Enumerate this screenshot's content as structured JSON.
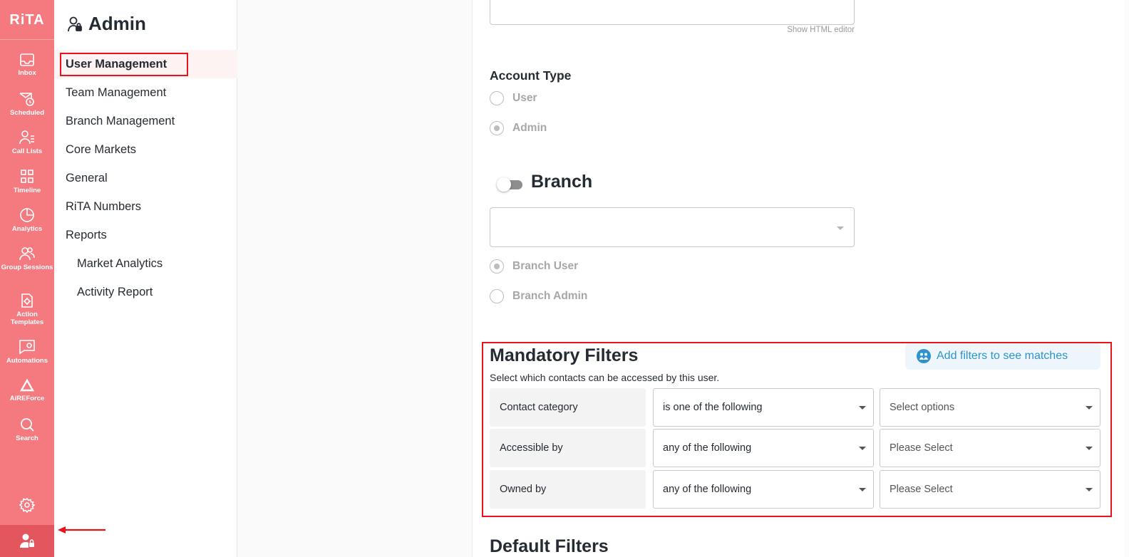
{
  "rail": {
    "logo": "RiTA",
    "items": [
      {
        "label": "Inbox",
        "icon": "inbox-icon"
      },
      {
        "label": "Scheduled",
        "icon": "scheduled-icon"
      },
      {
        "label": "Call Lists",
        "icon": "call-lists-icon"
      },
      {
        "label": "Timeline",
        "icon": "timeline-icon"
      },
      {
        "label": "Analytics",
        "icon": "analytics-icon"
      },
      {
        "label": "Group Sessions",
        "icon": "group-sessions-icon"
      },
      {
        "label": "Action Templates",
        "icon": "action-templates-icon"
      },
      {
        "label": "Automations",
        "icon": "automations-icon"
      },
      {
        "label": "AiREForce",
        "icon": "aireforce-icon"
      },
      {
        "label": "Search",
        "icon": "search-icon"
      }
    ],
    "bottom": [
      "settings-icon",
      "admin-user-icon"
    ],
    "color": "#f47a80",
    "active_color": "#e4565e"
  },
  "nav": {
    "title": "Admin",
    "items": [
      {
        "label": "User Management",
        "active": true
      },
      {
        "label": "Team Management"
      },
      {
        "label": "Branch Management"
      },
      {
        "label": "Core Markets"
      },
      {
        "label": "General"
      },
      {
        "label": "RiTA Numbers"
      },
      {
        "label": "Reports"
      },
      {
        "label": "Market Analytics",
        "sub": true
      },
      {
        "label": "Activity Report",
        "sub": true
      }
    ]
  },
  "form": {
    "show_html_editor": "Show HTML editor",
    "account_type": {
      "label": "Account Type",
      "options": [
        {
          "label": "User",
          "checked": false
        },
        {
          "label": "Admin",
          "checked": true
        }
      ]
    },
    "branch": {
      "label": "Branch",
      "toggle_on": false,
      "select_value": "",
      "options": [
        {
          "label": "Branch User",
          "checked": true
        },
        {
          "label": "Branch Admin",
          "checked": false
        }
      ]
    },
    "mandatory_filters": {
      "title": "Mandatory Filters",
      "subtitle": "Select which contacts can be accessed by this user.",
      "add_button": "Add filters to see matches",
      "rows": [
        {
          "field": "Contact category",
          "operator": "is one of the following",
          "value": "Select options"
        },
        {
          "field": "Accessible by",
          "operator": "any of the following",
          "value": "Please Select"
        },
        {
          "field": "Owned by",
          "operator": "any of the following",
          "value": "Please Select"
        }
      ]
    },
    "default_filters": {
      "title": "Default Filters"
    }
  },
  "colors": {
    "accent": "#f47a80",
    "highlight": "#e8141d",
    "link": "#2e93c9"
  }
}
